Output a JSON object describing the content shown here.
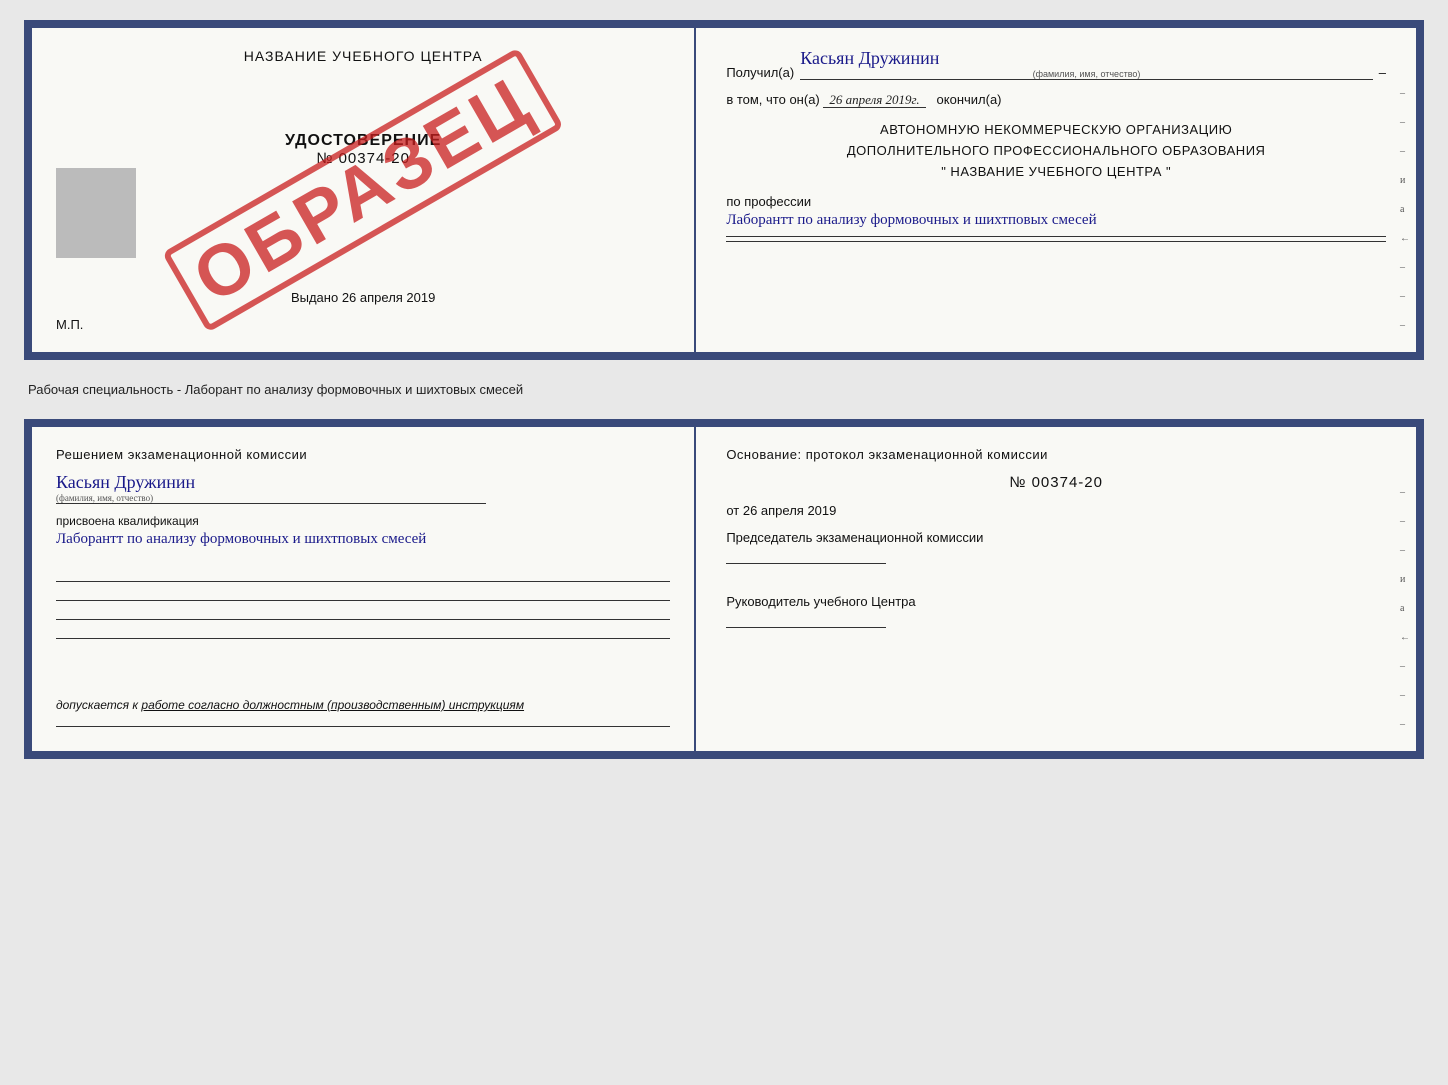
{
  "top_cert": {
    "left": {
      "training_center": "НАЗВАНИЕ УЧЕБНОГО ЦЕНТРА",
      "certificate_label": "УДОСТОВЕРЕНИЕ",
      "cert_number": "№ 00374-20",
      "issued_label": "Выдано",
      "issued_date": "26 апреля 2019",
      "mp_label": "М.П.",
      "stamp_text": "ОБРАЗЕЦ"
    },
    "right": {
      "received_label": "Получил(а)",
      "recipient_name": "Касьян Дружинин",
      "recipient_subtitle": "(фамилия, имя, отчество)",
      "date_label": "в том, что он(а)",
      "date_value": "26 апреля 2019г.",
      "finished_label": "окончил(а)",
      "org_line1": "АВТОНОМНУЮ НЕКОММЕРЧЕСКУЮ ОРГАНИЗАЦИЮ",
      "org_line2": "ДОПОЛНИТЕЛЬНОГО ПРОФЕССИОНАЛЬНОГО ОБРАЗОВАНИЯ",
      "org_line3": "\"   НАЗВАНИЕ УЧЕБНОГО ЦЕНТРА   \"",
      "profession_label": "по профессии",
      "profession_value": "Лаборантт по анализу формовочных и шихтповых смесей",
      "right_marks": [
        "–",
        "–",
        "–",
        "и",
        "а",
        "←",
        "–",
        "–",
        "–"
      ]
    }
  },
  "separator": {
    "text": "Рабочая специальность - Лаборант по анализу формовочных и шихтовых смесей"
  },
  "bottom_cert": {
    "left": {
      "decision_label": "Решением экзаменационной комиссии",
      "person_name": "Касьян Дружинин",
      "person_subtitle": "(фамилия, имя, отчество)",
      "qualification_label": "присвоена квалификация",
      "qualification_value": "Лаборантт по анализу формовочных и шихтповых смесей",
      "allowed_label": "допускается к",
      "allowed_value": "работе согласно должностным (производственным) инструкциям"
    },
    "right": {
      "basis_label": "Основание: протокол экзаменационной комиссии",
      "protocol_number": "№ 00374-20",
      "protocol_date_prefix": "от",
      "protocol_date": "26 апреля 2019",
      "chairman_label": "Председатель экзаменационной комиссии",
      "director_label": "Руководитель учебного Центра",
      "right_marks": [
        "–",
        "–",
        "–",
        "и",
        "а",
        "←",
        "–",
        "–",
        "–"
      ]
    }
  }
}
